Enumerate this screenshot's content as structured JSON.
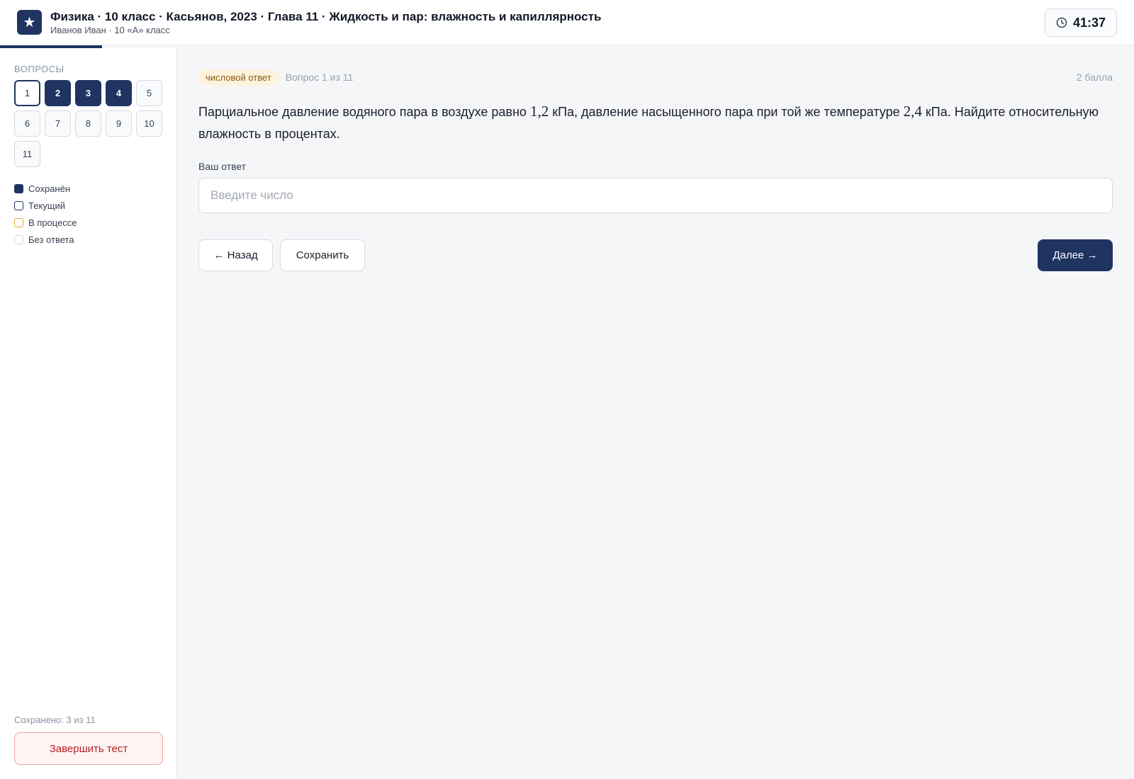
{
  "header": {
    "logo_glyph": "★",
    "title": "Физика · 10 класс · Касьянов, 2023 · Глава 11 · Жидкость и пар: влажность и капиллярность",
    "subtitle": "Иванов Иван · 10 «А» класс",
    "timer": "41:37",
    "timer_icon": "clock-icon"
  },
  "sidebar": {
    "label": "ВОПРОСЫ",
    "questions": [
      {
        "label": "1",
        "state": "current"
      },
      {
        "label": "2",
        "state": "saved"
      },
      {
        "label": "3",
        "state": "saved"
      },
      {
        "label": "4",
        "state": "saved"
      },
      {
        "label": "5",
        "state": "none"
      },
      {
        "label": "6",
        "state": "none"
      },
      {
        "label": "7",
        "state": "none"
      },
      {
        "label": "8",
        "state": "none"
      },
      {
        "label": "9",
        "state": "none"
      },
      {
        "label": "10",
        "state": "none"
      },
      {
        "label": "11",
        "state": "none"
      }
    ],
    "legend": {
      "saved": "Сохранён",
      "current": "Текущий",
      "in_progress": "В процессе",
      "no_answer": "Без ответа"
    },
    "saved_count": "Сохранено: 3 из 11",
    "finish_label": "Завершить тест"
  },
  "main": {
    "type_badge": "числовой ответ",
    "question_index": "Вопрос 1 из 11",
    "points": "2 балла",
    "question": {
      "part1": "Парциальное давление водяного пара в воздухе равно ",
      "value1": "1,2",
      "part2": " кПа, давление насыщенного пара при той же температуре ",
      "value2": "2,4",
      "part3": " кПа. Найдите относительную влажность в процентах."
    },
    "answer_label": "Ваш ответ",
    "answer_value": "",
    "answer_placeholder": "Введите число",
    "back_label": "← Назад",
    "save_label": "Сохранить",
    "next_label": "Далее →"
  },
  "colors": {
    "accent": "#1f3461",
    "in_progress": "#e0a93a",
    "danger": "#b42323",
    "badge_bg": "#fdf3dc"
  }
}
